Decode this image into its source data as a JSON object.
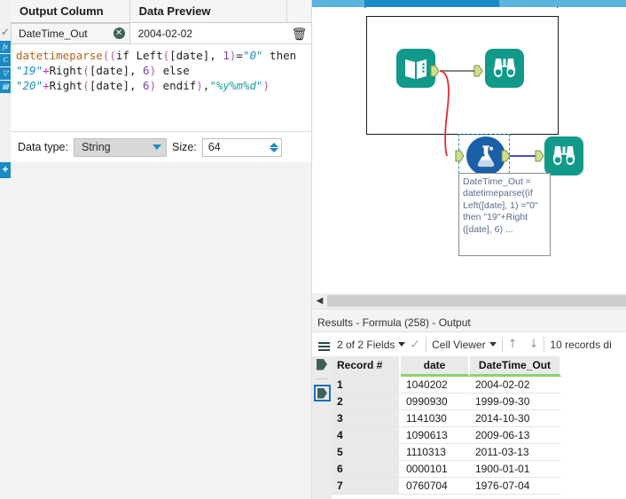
{
  "config_panel": {
    "columns": {
      "output_column": "Output Column",
      "data_preview": "Data Preview"
    },
    "row": {
      "field_name": "DateTime_Out",
      "preview_value": "2004-02-02",
      "clear_icon": "circle-x-icon",
      "delete_icon": "trash-icon"
    },
    "formula": {
      "full_text": "datetimeparse((if Left([date], 1)=\"0\" then \"19\"+Right([date], 6) else \"20\"+Right([date], 6) endif),\"%y%m%d\")",
      "tokens": [
        {
          "t": "datetimeparse",
          "c": "fn"
        },
        {
          "t": "((",
          "c": "paren"
        },
        {
          "t": "if",
          "c": "plain"
        },
        {
          "t": " Left",
          "c": "plain"
        },
        {
          "t": "(",
          "c": "paren"
        },
        {
          "t": "[date]",
          "c": "plain"
        },
        {
          "t": ", ",
          "c": "plain"
        },
        {
          "t": "1",
          "c": "num"
        },
        {
          "t": ")",
          "c": "paren"
        },
        {
          "t": "=",
          "c": "plain"
        },
        {
          "t": "\"0\"",
          "c": "str"
        },
        {
          "t": " then ",
          "c": "plain"
        },
        {
          "t": "\"19\"",
          "c": "str"
        },
        {
          "t": "+",
          "c": "op"
        },
        {
          "t": "Right",
          "c": "plain"
        },
        {
          "t": "(",
          "c": "paren"
        },
        {
          "t": "[date]",
          "c": "plain"
        },
        {
          "t": ", ",
          "c": "plain"
        },
        {
          "t": "6",
          "c": "num"
        },
        {
          "t": ")",
          "c": "paren"
        },
        {
          "t": " else ",
          "c": "plain"
        },
        {
          "t": "\"20\"",
          "c": "str"
        },
        {
          "t": "+",
          "c": "op"
        },
        {
          "t": "Right",
          "c": "plain"
        },
        {
          "t": "(",
          "c": "paren"
        },
        {
          "t": "[date]",
          "c": "plain"
        },
        {
          "t": ", ",
          "c": "plain"
        },
        {
          "t": "6",
          "c": "num"
        },
        {
          "t": ")",
          "c": "paren"
        },
        {
          "t": " endif",
          "c": "plain"
        },
        {
          "t": ")",
          "c": "paren"
        },
        {
          "t": ",",
          "c": "plain"
        },
        {
          "t": "\"%y%m%d\"",
          "c": "fmt"
        },
        {
          "t": ")",
          "c": "paren"
        }
      ]
    },
    "data_type": {
      "label": "Data type:",
      "value": "String",
      "size_label": "Size:",
      "size_value": "64"
    },
    "toolstrip": [
      {
        "name": "formula-fx-icon",
        "glyph": "fx"
      },
      {
        "name": "conditional-icon",
        "glyph": "C"
      },
      {
        "name": "datetime-icon",
        "glyph": "▽"
      },
      {
        "name": "save-formula-icon",
        "glyph": "▤"
      }
    ],
    "valid_check_icon": "green-check-icon",
    "add_button_label": "+"
  },
  "canvas": {
    "nodes": [
      {
        "name": "input-data-tool",
        "icon": "book-icon",
        "type": "teal"
      },
      {
        "name": "browse-tool-top",
        "icon": "binoculars-icon",
        "type": "teal"
      },
      {
        "name": "formula-tool",
        "icon": "flask-icon",
        "type": "blue",
        "selected": true
      },
      {
        "name": "browse-tool-bottom",
        "icon": "binoculars-icon",
        "type": "teal"
      }
    ],
    "annotation": "DateTime_Out = datetimeparse((if Left([date], 1) =\"0\" then \"19\"+Right ([date], 6) ...",
    "scroll_left_arrow": "◀"
  },
  "results": {
    "title": "Results - Formula (258) - Output",
    "toolbar": {
      "fields_selector": "2 of 2 Fields",
      "view_mode": "Cell Viewer",
      "records_label": "10 records di",
      "sort_up_icon": "arrow-up-icon",
      "sort_down_icon": "arrow-down-icon",
      "list-icon": "list-icon",
      "check_icon": "check-icon"
    },
    "table": {
      "headers": [
        "Record #",
        "date",
        "DateTime_Out"
      ],
      "rows": [
        [
          "1",
          "1040202",
          "2004-02-02"
        ],
        [
          "2",
          "0990930",
          "1999-09-30"
        ],
        [
          "3",
          "1141030",
          "2014-10-30"
        ],
        [
          "4",
          "1090613",
          "2009-06-13"
        ],
        [
          "5",
          "1110313",
          "2011-03-13"
        ],
        [
          "6",
          "0000101",
          "1900-01-01"
        ],
        [
          "7",
          "0760704",
          "1976-07-04"
        ]
      ]
    }
  },
  "colors": {
    "accent_blue": "#1b8bc4",
    "teal_node": "#11998a",
    "blue_node": "#1b5fa8",
    "green_underline": "#8cd46a",
    "connection_red": "#e8292f",
    "connection_blue": "#3333cc"
  }
}
